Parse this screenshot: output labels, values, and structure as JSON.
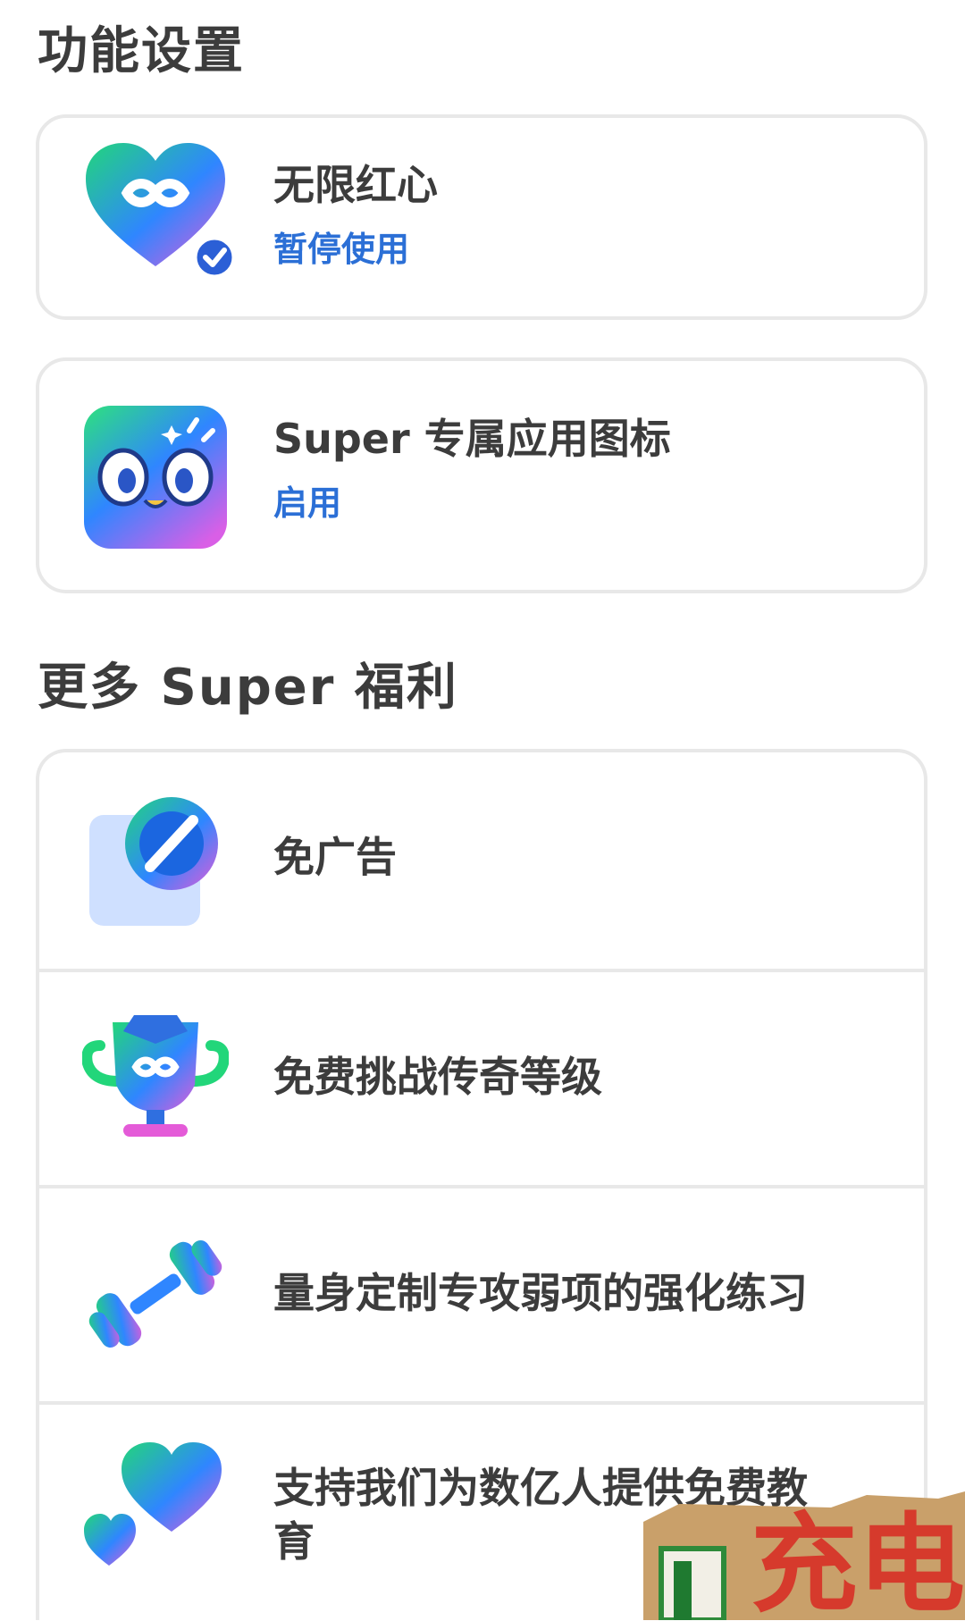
{
  "feature_settings": {
    "title": "功能设置",
    "items": [
      {
        "title": "无限红心",
        "status": "暂停使用",
        "icon": "infinite-hearts-icon"
      },
      {
        "title": "Super 专属应用图标",
        "status": "启用",
        "icon": "super-app-icon"
      }
    ]
  },
  "more_benefits": {
    "title": "更多 Super 福利",
    "items": [
      {
        "title": "免广告",
        "icon": "no-ads-icon"
      },
      {
        "title": "免费挑战传奇等级",
        "icon": "trophy-icon"
      },
      {
        "title": "量身定制专攻弱项的强化练习",
        "icon": "dumbbell-icon"
      },
      {
        "title": "支持我们为数亿人提供免费教育",
        "icon": "hearts-support-icon"
      }
    ]
  },
  "colors": {
    "accent_blue": "#2b6fd6",
    "gradient_green": "#22d67a",
    "gradient_blue": "#2f86ff",
    "gradient_pink": "#e45bd8"
  },
  "sticker": {
    "text": "充电"
  }
}
